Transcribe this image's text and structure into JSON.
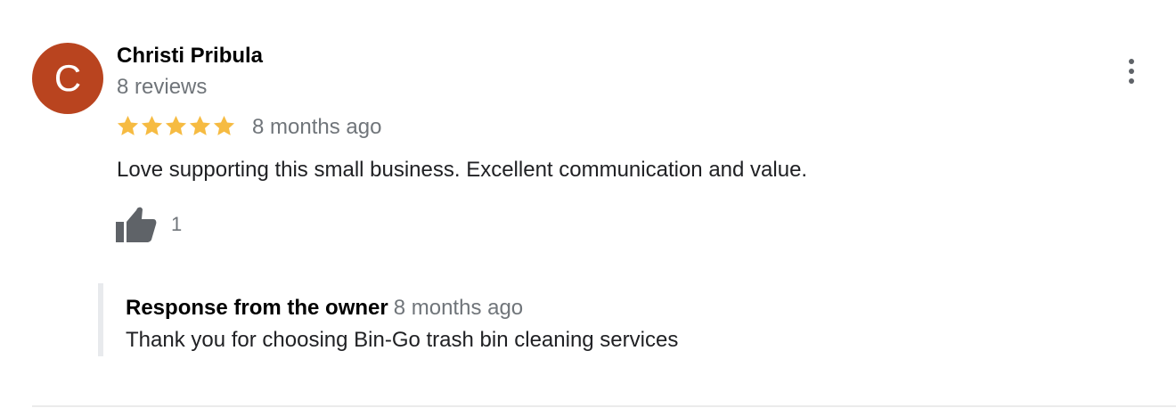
{
  "reviewer": {
    "initial": "C",
    "name": "Christi Pribula",
    "review_count": "8 reviews",
    "avatar_color": "#b9441f"
  },
  "review": {
    "rating": 5,
    "max_rating": 5,
    "star_color": "#f6bb42",
    "time": "8 months ago",
    "text": "Love supporting this small business. Excellent communication and value.",
    "like_count": "1",
    "like_icon": "thumbs-up-icon",
    "menu_icon": "more-vert-icon"
  },
  "owner_response": {
    "label": "Response from the owner",
    "time": "8 months ago",
    "text": "Thank you for choosing Bin-Go trash bin cleaning services"
  }
}
